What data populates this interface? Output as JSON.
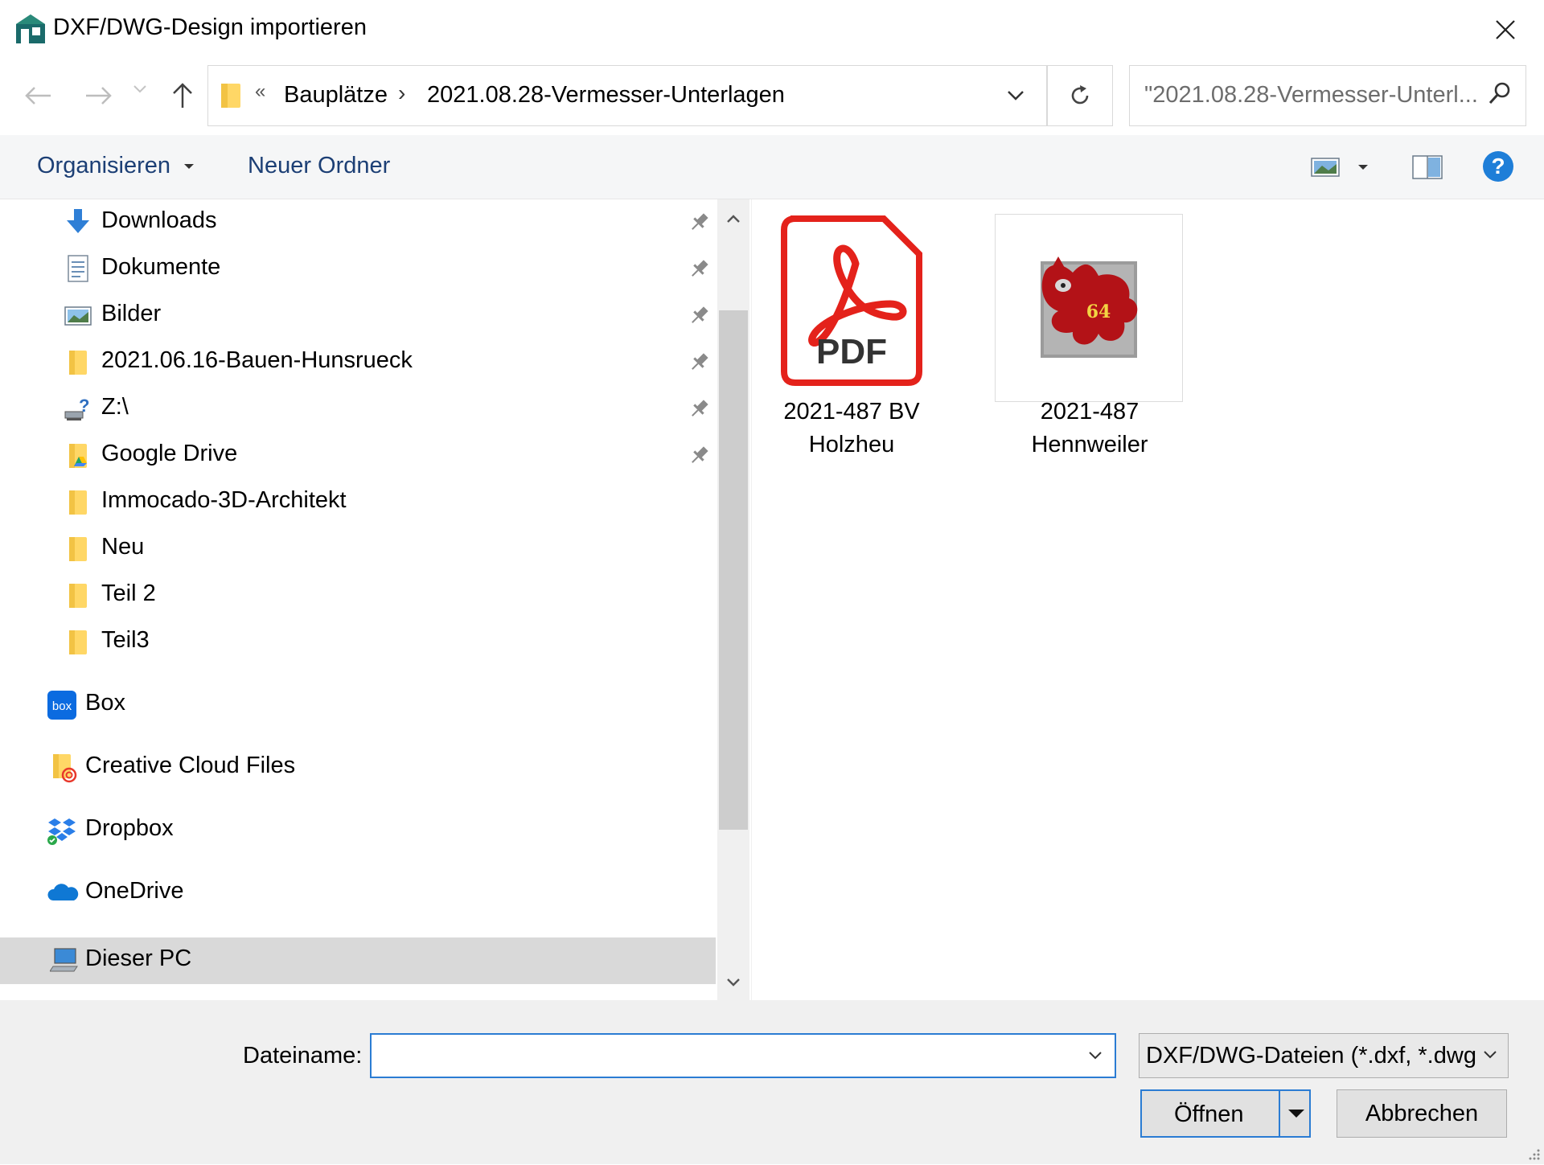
{
  "window": {
    "title": "DXF/DWG-Design importieren"
  },
  "address": {
    "overflow_marker": "«",
    "crumbs": [
      "Bauplätze",
      "2021.08.28-Vermesser-Unterlagen"
    ],
    "separator": "›"
  },
  "search": {
    "value": "\"2021.08.28-Vermesser-Unterl..."
  },
  "commandbar": {
    "organize_label": "Organisieren",
    "new_folder_label": "Neuer Ordner",
    "help_label": "?"
  },
  "nav": {
    "quick_access": [
      {
        "label": "Downloads",
        "icon": "download-arrow-icon",
        "pinned": true
      },
      {
        "label": "Dokumente",
        "icon": "document-icon",
        "pinned": true
      },
      {
        "label": "Bilder",
        "icon": "pictures-icon",
        "pinned": true
      },
      {
        "label": "2021.06.16-Bauen-Hunsrueck",
        "icon": "folder-icon",
        "pinned": true
      },
      {
        "label": "Z:\\",
        "icon": "network-drive-icon",
        "pinned": true
      },
      {
        "label": "Google Drive",
        "icon": "google-drive-folder-icon",
        "pinned": true
      },
      {
        "label": "Immocado-3D-Architekt",
        "icon": "folder-icon",
        "pinned": false
      },
      {
        "label": "Neu",
        "icon": "folder-icon",
        "pinned": false
      },
      {
        "label": "Teil 2",
        "icon": "folder-icon",
        "pinned": false
      },
      {
        "label": "Teil3",
        "icon": "folder-icon",
        "pinned": false
      }
    ],
    "locations": [
      {
        "label": "Box",
        "icon": "box-icon"
      },
      {
        "label": "Creative Cloud Files",
        "icon": "creative-cloud-icon"
      },
      {
        "label": "Dropbox",
        "icon": "dropbox-icon"
      },
      {
        "label": "OneDrive",
        "icon": "onedrive-icon"
      },
      {
        "label": "Dieser PC",
        "icon": "this-pc-icon",
        "selected": true
      }
    ]
  },
  "files": [
    {
      "name_line1": "2021-487 BV",
      "name_line2": "Holzheu",
      "type": "pdf",
      "badge": "PDF"
    },
    {
      "name_line1": "2021-487",
      "name_line2": "Hennweiler",
      "type": "image",
      "badge": "64"
    }
  ],
  "bottom": {
    "filename_label": "Dateiname:",
    "filename_value": "",
    "filetype_value": "DXF/DWG-Dateien (*.dxf, *.dwg",
    "open_label": "Öffnen",
    "cancel_label": "Abbrechen"
  },
  "colors": {
    "accent": "#2b7cd3",
    "link": "#1c3f75",
    "pdf_red": "#e4221b",
    "help_blue": "#1e7ed8",
    "folder_yellow": "#ffd766"
  }
}
